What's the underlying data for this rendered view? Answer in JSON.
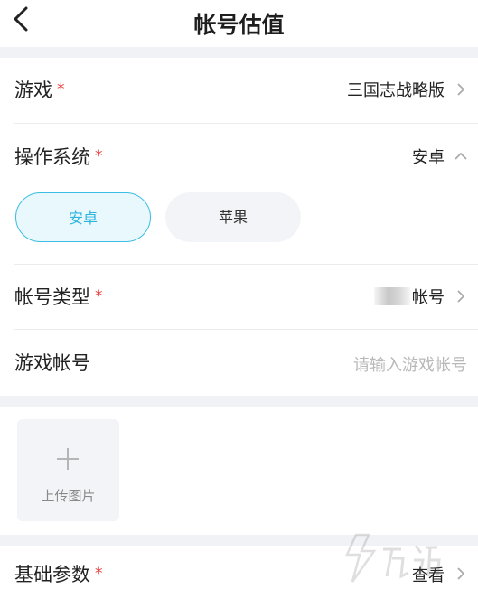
{
  "header": {
    "title": "帐号估值"
  },
  "fields": {
    "game": {
      "label": "游戏",
      "required_mark": "*",
      "value": "三国志战略版"
    },
    "os": {
      "label": "操作系统",
      "required_mark": "*",
      "value": "安卓",
      "options": [
        {
          "label": "安卓",
          "selected": true
        },
        {
          "label": "苹果",
          "selected": false
        }
      ]
    },
    "account_type": {
      "label": "帐号类型",
      "required_mark": "*",
      "value": "帐号"
    },
    "game_account": {
      "label": "游戏帐号",
      "placeholder": "请输入游戏帐号"
    },
    "base_params": {
      "label": "基础参数",
      "required_mark": "*",
      "value": "查看"
    }
  },
  "upload": {
    "label": "上传图片"
  },
  "colors": {
    "accent": "#2ab4de",
    "required": "#e53935",
    "band": "#f1f2f5"
  },
  "icons": {
    "back": "chevron-left-icon",
    "chevron": "chevron-right-icon",
    "expand": "chevron-up-icon",
    "plus": "plus-icon"
  }
}
